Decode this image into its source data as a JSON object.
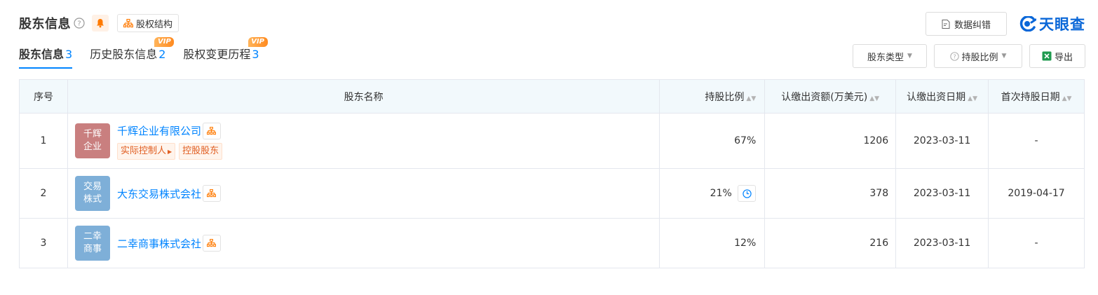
{
  "header": {
    "title": "股东信息",
    "structure_button": "股权结构",
    "report_button": "数据纠错",
    "brand": "天眼查"
  },
  "tabs": [
    {
      "label": "股东信息",
      "count": "3",
      "active": true,
      "vip": false
    },
    {
      "label": "历史股东信息",
      "count": "2",
      "active": false,
      "vip": true
    },
    {
      "label": "股权变更历程",
      "count": "3",
      "active": false,
      "vip": true
    }
  ],
  "vip_label": "VIP",
  "filters": {
    "holder_type": "股东类型",
    "share_ratio": "持股比例",
    "export": "导出"
  },
  "table": {
    "headers": {
      "index": "序号",
      "name": "股东名称",
      "ratio": "持股比例",
      "amount": "认缴出资额(万美元)",
      "date": "认缴出资日期",
      "first_date": "首次持股日期"
    },
    "rows": [
      {
        "index": "1",
        "logo_text": "千辉企业",
        "logo_color": "#c97f7f",
        "name": "千辉企业有限公司",
        "tags": [
          "实际控制人",
          "控股股东"
        ],
        "ratio": "67%",
        "amount": "1206",
        "date": "2023-03-11",
        "first_date": "-"
      },
      {
        "index": "2",
        "logo_text": "交易株式",
        "logo_color": "#7eafd8",
        "name": "大东交易株式会社",
        "tags": [],
        "ratio": "21%",
        "amount": "378",
        "date": "2023-03-11",
        "first_date": "2019-04-17"
      },
      {
        "index": "3",
        "logo_text": "二幸商事",
        "logo_color": "#7eafd8",
        "name": "二幸商事株式会社",
        "tags": [],
        "ratio": "12%",
        "amount": "216",
        "date": "2023-03-11",
        "first_date": "-"
      }
    ]
  },
  "colors": {
    "accent": "#0084ff",
    "orange": "#ff7a00",
    "header_bg": "#f2f9fc"
  }
}
